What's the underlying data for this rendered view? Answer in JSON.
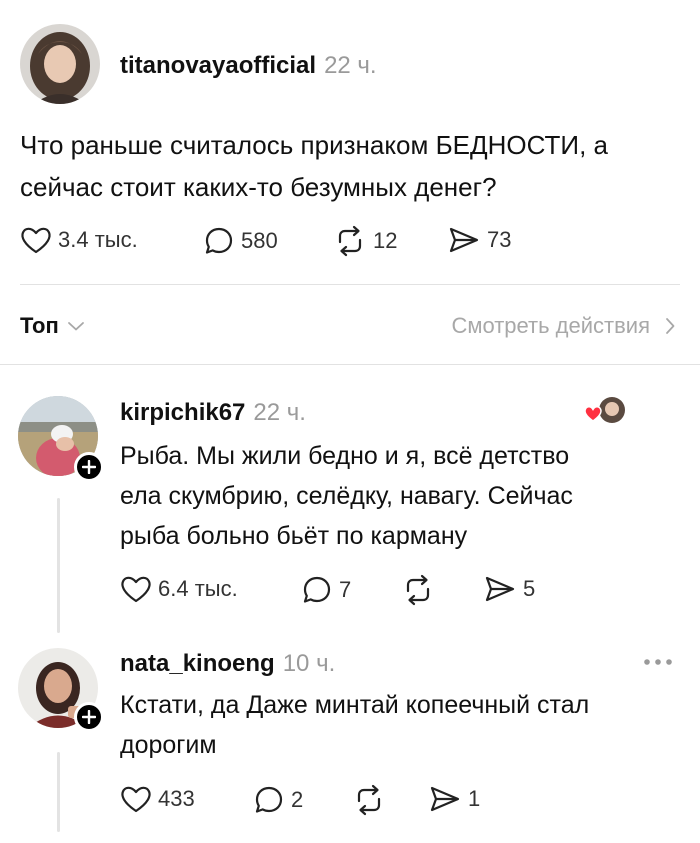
{
  "post": {
    "username": "titanovayaofficial",
    "time": "22 ч.",
    "text_line1": "Что раньше считалось признаком БЕДНОСТИ, а",
    "text_line2": "сейчас стоит каких-то безумных денег?",
    "likes": "3.4 тыс.",
    "comments": "580",
    "reposts": "12",
    "shares": "73"
  },
  "sort_bar": {
    "sort_label": "Топ",
    "activity_label": "Смотреть действия"
  },
  "comments": [
    {
      "username": "kirpichik67",
      "time": "22 ч.",
      "line1": "Рыба. Мы жили бедно и я, всё детство",
      "line2": "ела скумбрию, селёдку, навагу. Сейчас",
      "line3": "рыба больно бьёт по карману",
      "likes": "6.4 тыс.",
      "comments": "7",
      "reposts": "",
      "shares": "5"
    },
    {
      "username": "nata_kinoeng",
      "time": "10 ч.",
      "line1": "Кстати, да Даже минтай копеечный стал",
      "line2": "дорогим",
      "likes": "433",
      "comments": "2",
      "reposts": "",
      "shares": "1"
    }
  ],
  "icons": {
    "like": "heart-icon",
    "comment": "comment-bubble-icon",
    "repost": "repost-icon",
    "share": "share-icon",
    "more": "more-dots-icon",
    "chevron_down": "chevron-down-icon",
    "chevron_right": "chevron-right-icon",
    "liked_by_author": "author-liked-heart-icon"
  },
  "colors": {
    "liked_heart": "#ff3040",
    "muted_text": "#9a9a9a"
  }
}
